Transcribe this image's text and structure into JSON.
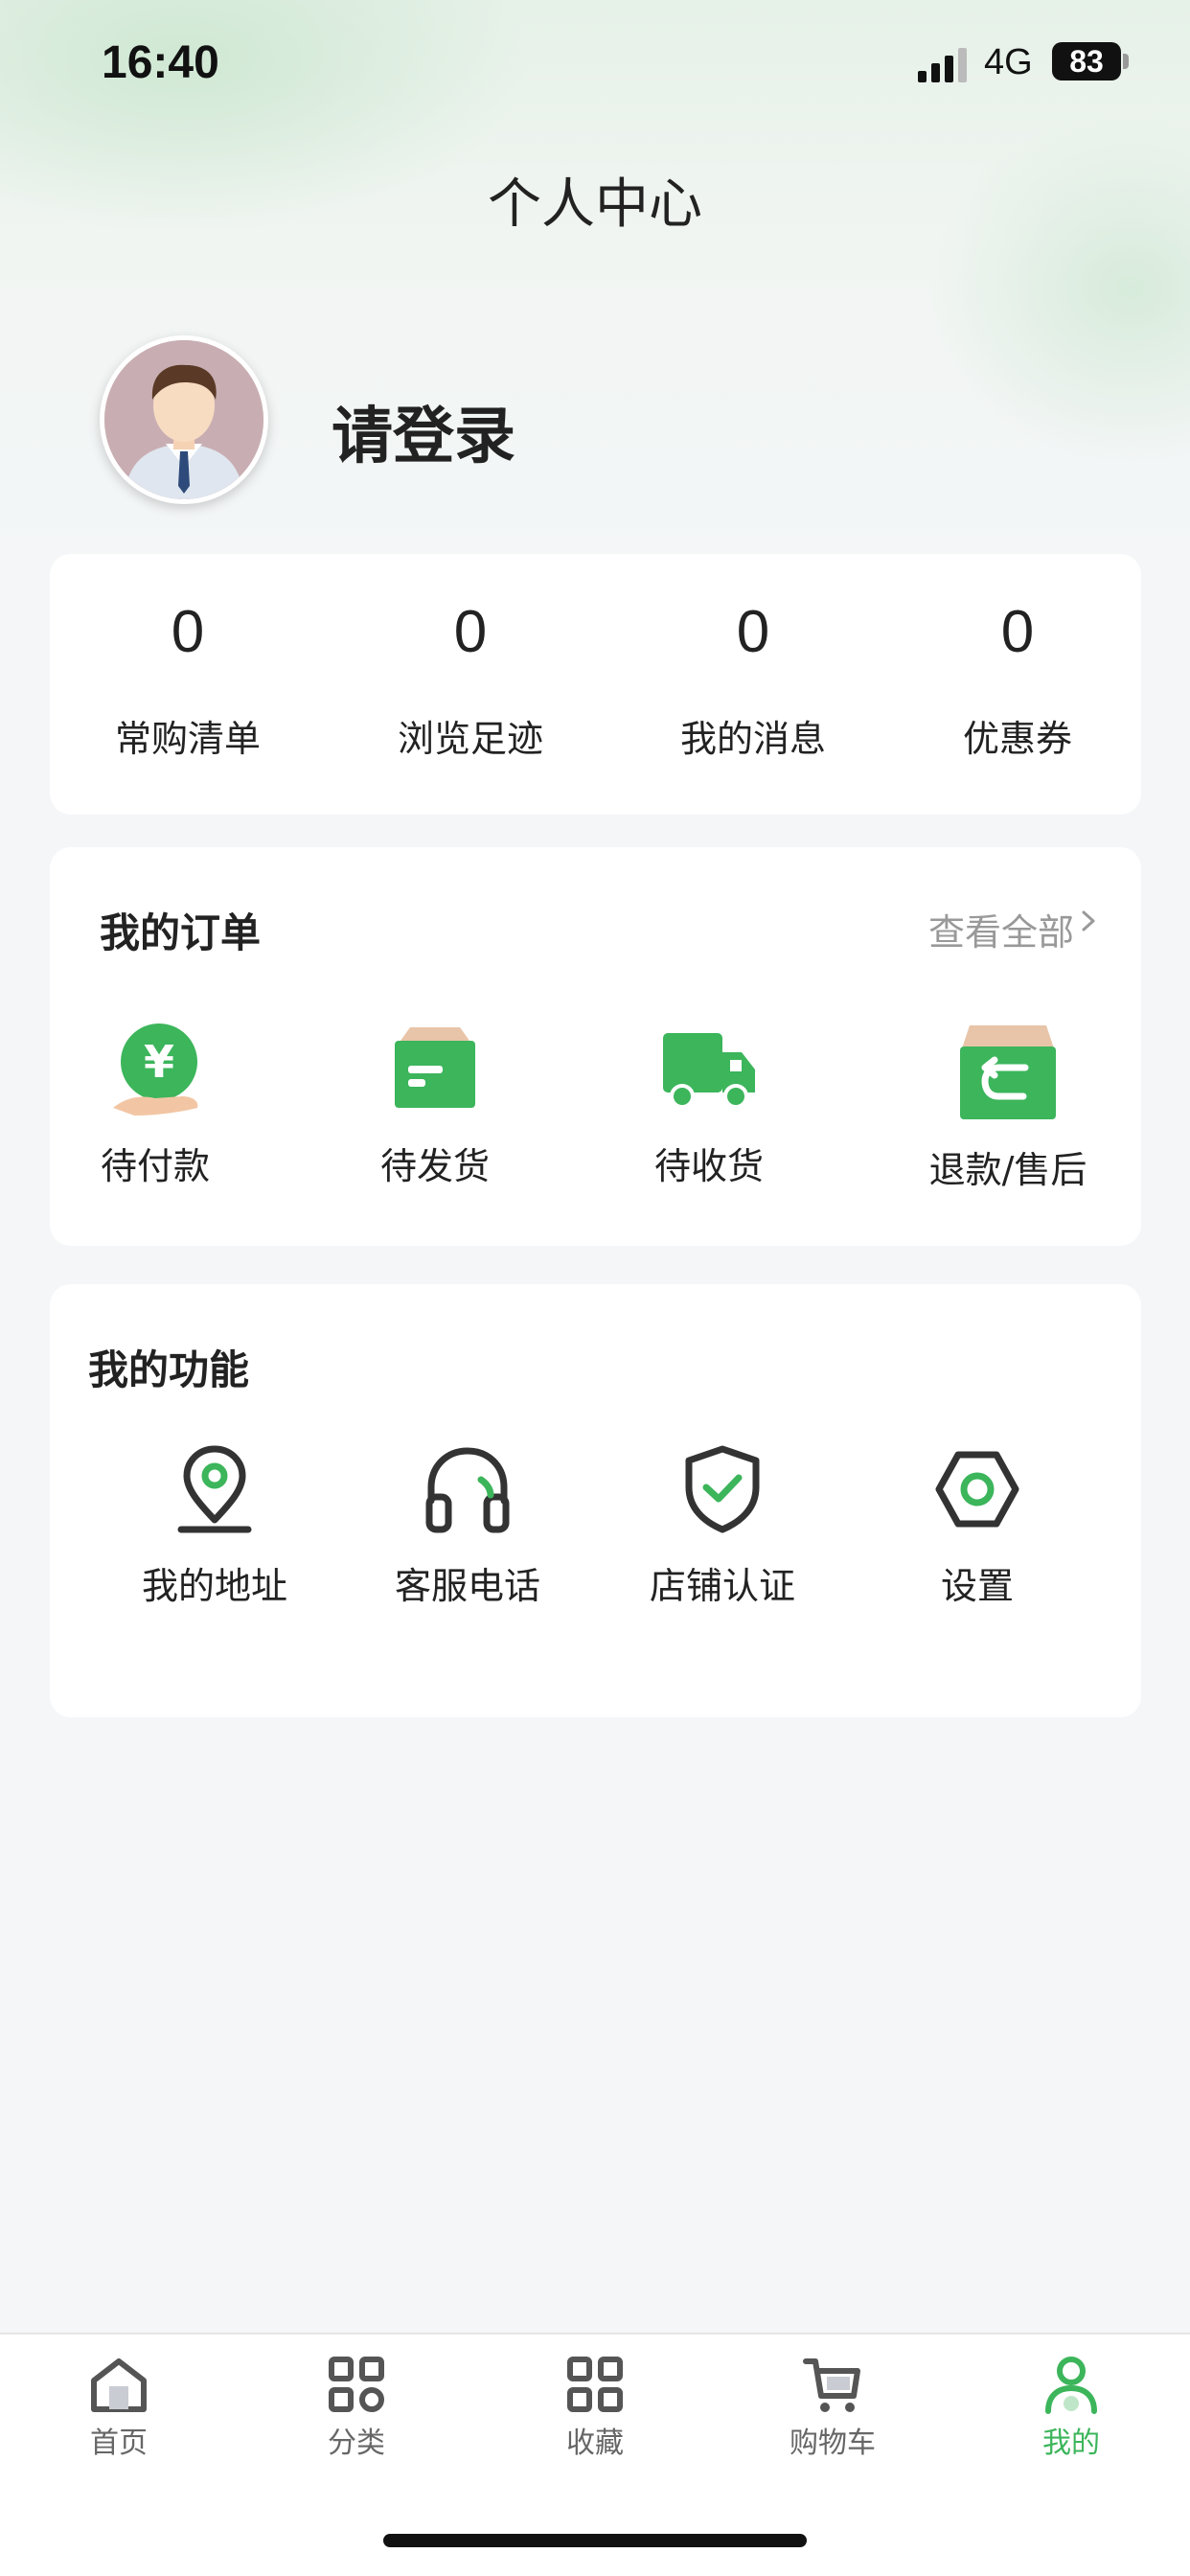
{
  "status_bar": {
    "time": "16:40",
    "network": "4G",
    "battery": "83"
  },
  "header": {
    "title": "个人中心"
  },
  "profile": {
    "login_text": "请登录"
  },
  "stats": [
    {
      "value": "0",
      "label": "常购清单"
    },
    {
      "value": "0",
      "label": "浏览足迹"
    },
    {
      "value": "0",
      "label": "我的消息"
    },
    {
      "value": "0",
      "label": "优惠券"
    }
  ],
  "orders": {
    "title": "我的订单",
    "view_all": "查看全部",
    "items": [
      {
        "label": "待付款",
        "icon": "payment-pending-icon"
      },
      {
        "label": "待发货",
        "icon": "box-icon"
      },
      {
        "label": "待收货",
        "icon": "truck-icon"
      },
      {
        "label": "退款/售后",
        "icon": "refund-icon"
      }
    ]
  },
  "functions": {
    "title": "我的功能",
    "items": [
      {
        "label": "我的地址",
        "icon": "location-pin-icon"
      },
      {
        "label": "客服电话",
        "icon": "headset-icon"
      },
      {
        "label": "店铺认证",
        "icon": "shield-check-icon"
      },
      {
        "label": "设置",
        "icon": "settings-hexagon-icon"
      }
    ]
  },
  "tabbar": {
    "items": [
      {
        "label": "首页",
        "icon": "home-icon"
      },
      {
        "label": "分类",
        "icon": "category-icon"
      },
      {
        "label": "收藏",
        "icon": "favorites-grid-icon"
      },
      {
        "label": "购物车",
        "icon": "cart-icon"
      },
      {
        "label": "我的",
        "icon": "user-icon"
      }
    ],
    "active": "我的"
  },
  "colors": {
    "accent": "#3cb55b",
    "box_top": "#e8c4a8",
    "text": "#222222",
    "muted": "#999999"
  }
}
